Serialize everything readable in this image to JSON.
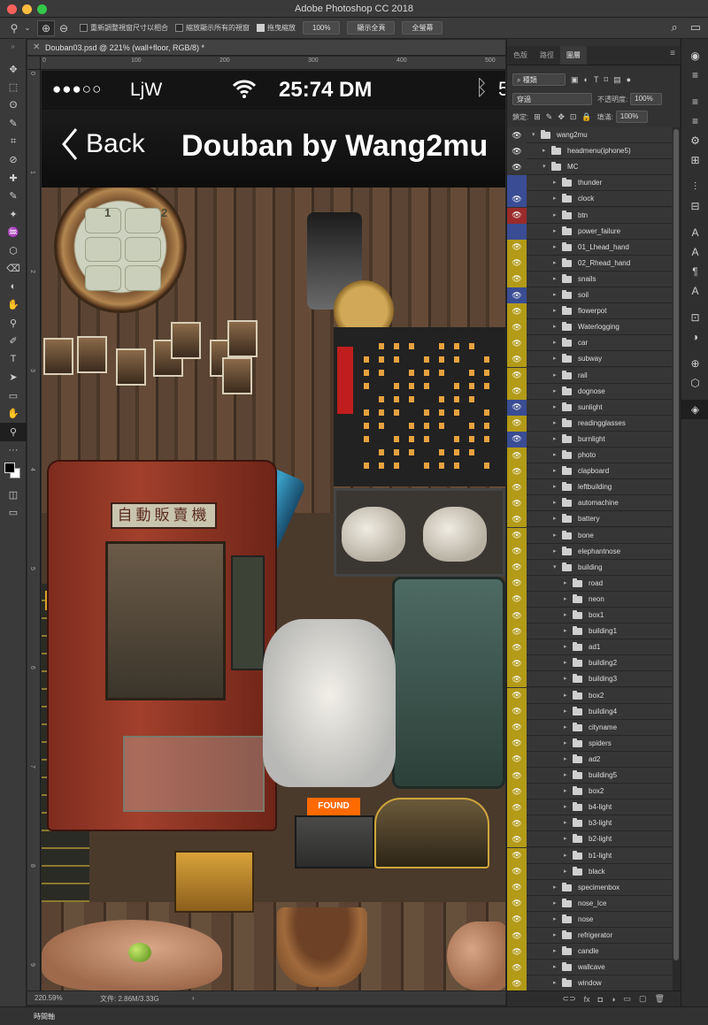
{
  "app": {
    "title": "Adobe Photoshop CC 2018"
  },
  "options": {
    "check1": "重新調整視窗尺寸以相合",
    "check2": "縮放顯示所有的視窗",
    "check3": "拖曳縮放",
    "zoom": "100%",
    "fit_btn": "顯示全頁",
    "fill_btn": "全螢幕"
  },
  "document": {
    "tab": "Douban03.psd @ 221% (wall+floor, RGB/8) *",
    "ruler_top": [
      "0",
      "100",
      "200",
      "300",
      "400",
      "500"
    ],
    "ruler_left": [
      "0",
      "1",
      "2",
      "3",
      "4",
      "5",
      "6",
      "7",
      "8",
      "9"
    ],
    "zoom": "220.59%",
    "file": "文件: 2.86M/3.33G",
    "arrow": "›"
  },
  "mock": {
    "dots": "●●●○○",
    "carrier": "LjW",
    "time": "25:74 DM",
    "bt": "ᛒ",
    "batt": "5",
    "back": "Back",
    "title": "Douban by Wang2mu",
    "vending_sign": "自動販賣機",
    "found": "FOUND"
  },
  "panel": {
    "tabs": [
      "色版",
      "路徑",
      "圖層"
    ],
    "kind": "⌕ 種類",
    "blend": "穿過",
    "opacity_label": "不透明度:",
    "opacity": "100%",
    "lock_label": "鎖定:",
    "fill_label": "填滿:",
    "fill": "100%"
  },
  "layer_colors": {
    "yellow": "#b39a17",
    "blue": "#3a4d94",
    "red": "#9a2b2b",
    "none": "#363636"
  },
  "layers": [
    {
      "name": "wang2mu",
      "indent": 0,
      "open": true,
      "color": "none"
    },
    {
      "name": "headmenu(iphone5)",
      "indent": 1,
      "open": false,
      "color": "none"
    },
    {
      "name": "MC",
      "indent": 1,
      "open": true,
      "color": "none"
    },
    {
      "name": "thunder",
      "indent": 2,
      "open": false,
      "color": "blue",
      "hidden": true
    },
    {
      "name": "clock",
      "indent": 2,
      "open": false,
      "color": "blue"
    },
    {
      "name": "btn",
      "indent": 2,
      "open": false,
      "color": "red"
    },
    {
      "name": "power_failure",
      "indent": 2,
      "open": false,
      "color": "blue",
      "hidden": true
    },
    {
      "name": "01_Lhead_hand",
      "indent": 2,
      "open": false,
      "color": "yellow"
    },
    {
      "name": "02_Rhead_hand",
      "indent": 2,
      "open": false,
      "color": "yellow"
    },
    {
      "name": "snails",
      "indent": 2,
      "open": false,
      "color": "yellow"
    },
    {
      "name": "soil",
      "indent": 2,
      "open": false,
      "color": "blue"
    },
    {
      "name": "flowerpot",
      "indent": 2,
      "open": false,
      "color": "yellow"
    },
    {
      "name": "Waterlogging",
      "indent": 2,
      "open": false,
      "color": "yellow"
    },
    {
      "name": "car",
      "indent": 2,
      "open": false,
      "color": "yellow"
    },
    {
      "name": "subway",
      "indent": 2,
      "open": false,
      "color": "yellow"
    },
    {
      "name": "rail",
      "indent": 2,
      "open": false,
      "color": "yellow"
    },
    {
      "name": "dognose",
      "indent": 2,
      "open": false,
      "color": "yellow"
    },
    {
      "name": "sunlight",
      "indent": 2,
      "open": false,
      "color": "blue"
    },
    {
      "name": "readingglasses",
      "indent": 2,
      "open": false,
      "color": "yellow"
    },
    {
      "name": "burnlight",
      "indent": 2,
      "open": false,
      "color": "blue"
    },
    {
      "name": "photo",
      "indent": 2,
      "open": false,
      "color": "yellow"
    },
    {
      "name": "clapboard",
      "indent": 2,
      "open": false,
      "color": "yellow"
    },
    {
      "name": "leftbuilding",
      "indent": 2,
      "open": false,
      "color": "yellow"
    },
    {
      "name": "automachine",
      "indent": 2,
      "open": false,
      "color": "yellow"
    },
    {
      "name": "battery",
      "indent": 2,
      "open": false,
      "color": "yellow"
    },
    {
      "name": "bone",
      "indent": 2,
      "open": false,
      "color": "yellow"
    },
    {
      "name": "elephantnose",
      "indent": 2,
      "open": false,
      "color": "yellow"
    },
    {
      "name": "building",
      "indent": 2,
      "open": true,
      "color": "yellow"
    },
    {
      "name": "road",
      "indent": 3,
      "open": false,
      "color": "yellow"
    },
    {
      "name": "neon",
      "indent": 3,
      "open": false,
      "color": "yellow"
    },
    {
      "name": "box1",
      "indent": 3,
      "open": false,
      "color": "yellow"
    },
    {
      "name": "building1",
      "indent": 3,
      "open": false,
      "color": "yellow"
    },
    {
      "name": "ad1",
      "indent": 3,
      "open": false,
      "color": "yellow"
    },
    {
      "name": "building2",
      "indent": 3,
      "open": false,
      "color": "yellow"
    },
    {
      "name": "building3",
      "indent": 3,
      "open": false,
      "color": "yellow"
    },
    {
      "name": "box2",
      "indent": 3,
      "open": false,
      "color": "yellow"
    },
    {
      "name": "building4",
      "indent": 3,
      "open": false,
      "color": "yellow"
    },
    {
      "name": "cityname",
      "indent": 3,
      "open": false,
      "color": "yellow"
    },
    {
      "name": "spiders",
      "indent": 3,
      "open": false,
      "color": "yellow"
    },
    {
      "name": "ad2",
      "indent": 3,
      "open": false,
      "color": "yellow"
    },
    {
      "name": "building5",
      "indent": 3,
      "open": false,
      "color": "yellow"
    },
    {
      "name": "box2",
      "indent": 3,
      "open": false,
      "color": "yellow"
    },
    {
      "name": "b4-light",
      "indent": 3,
      "open": false,
      "color": "yellow"
    },
    {
      "name": "b3-light",
      "indent": 3,
      "open": false,
      "color": "yellow"
    },
    {
      "name": "b2-light",
      "indent": 3,
      "open": false,
      "color": "yellow"
    },
    {
      "name": "b1-light",
      "indent": 3,
      "open": false,
      "color": "yellow"
    },
    {
      "name": "black",
      "indent": 3,
      "open": false,
      "color": "yellow"
    },
    {
      "name": "specimenbox",
      "indent": 2,
      "open": false,
      "color": "yellow"
    },
    {
      "name": "nose_Ice",
      "indent": 2,
      "open": false,
      "color": "yellow"
    },
    {
      "name": "nose",
      "indent": 2,
      "open": false,
      "color": "yellow"
    },
    {
      "name": "refrigerator",
      "indent": 2,
      "open": false,
      "color": "yellow"
    },
    {
      "name": "candle",
      "indent": 2,
      "open": false,
      "color": "yellow"
    },
    {
      "name": "wallcave",
      "indent": 2,
      "open": false,
      "color": "yellow"
    },
    {
      "name": "window",
      "indent": 2,
      "open": false,
      "color": "yellow"
    }
  ],
  "panel_footer": [
    "⊂⊃",
    "fx",
    "◘",
    "◑",
    "▭",
    "▢",
    "🗑"
  ],
  "tools": [
    "✥",
    "⬚",
    "ʘ",
    "✎",
    "⌗",
    "⊘",
    "✚",
    "✎",
    "✦",
    "♒",
    "⬡",
    "⌫",
    "◐",
    "✋",
    "⚲",
    "✐",
    "T",
    "➤",
    "▭",
    "✋",
    "⚲",
    "···"
  ],
  "right_icons": [
    "◉",
    "≡",
    "≡",
    "≡",
    "⚙",
    "⊞",
    "⫶",
    "⊟",
    "A",
    "A",
    "¶",
    "A",
    "⊡",
    "◑",
    "⊕",
    "⬡",
    "◈"
  ],
  "timeline": "時間軸"
}
